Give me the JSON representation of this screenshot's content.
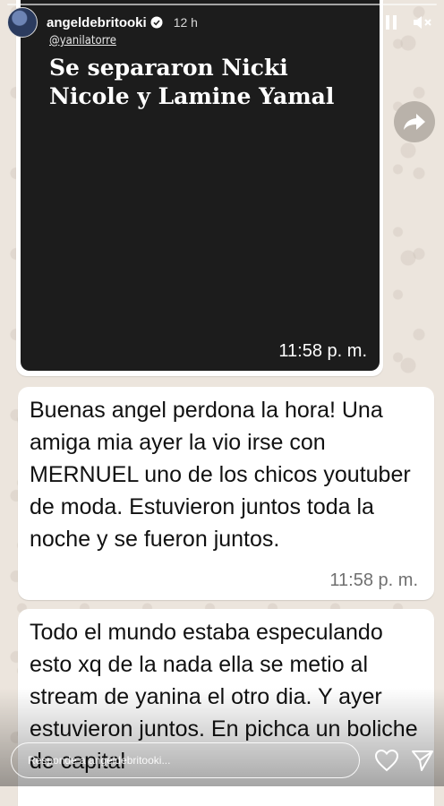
{
  "story": {
    "username": "angeldebritooki",
    "time_ago": "12 h",
    "reply_placeholder": "Responde a angeldebritooki..."
  },
  "image_message": {
    "handle": "@yanilatorre",
    "headline": "Se separaron Nicki Nicole y Lamine Yamal",
    "time": "11:58 p. m."
  },
  "messages": [
    {
      "text": "Buenas angel perdona la hora! Una amiga mia ayer la vio irse con MERNUEL uno de los chicos youtuber de moda. Estuvieron juntos toda la noche y se fueron juntos.",
      "time": "11:58 p. m."
    },
    {
      "text": "Todo el mundo estaba especulando esto xq de la nada ella se metio al stream de yanina el otro dia. Y ayer estuvieron juntos. En pichca un boliche de capital"
    }
  ],
  "icons": {
    "pause": "pause-icon",
    "mute": "mute-icon",
    "forward": "forward-icon",
    "heart": "heart-icon",
    "send": "send-icon",
    "verified": "verified-badge-icon"
  },
  "colors": {
    "wallpaper": "#ece5dd",
    "bubble": "#ffffff",
    "image_bg": "#1c1c1c"
  }
}
